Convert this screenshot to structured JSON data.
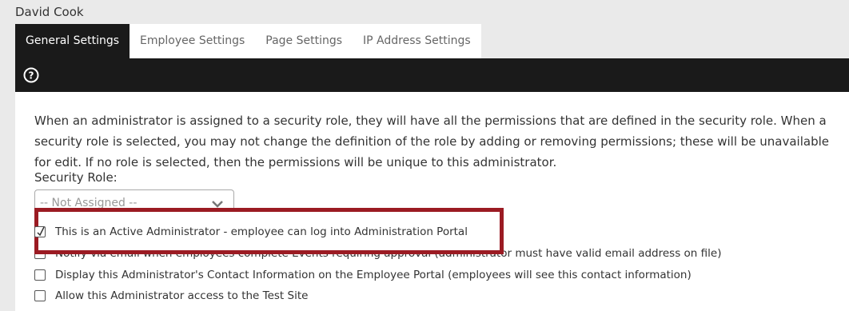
{
  "header": {
    "user_name": "David Cook"
  },
  "tabs": [
    {
      "label": "General Settings",
      "active": true
    },
    {
      "label": "Employee Settings",
      "active": false
    },
    {
      "label": "Page Settings",
      "active": false
    },
    {
      "label": "IP Address Settings",
      "active": false
    }
  ],
  "toolbar": {
    "help_icon": "question-circle-icon"
  },
  "content": {
    "description": "When an administrator is assigned to a security role, they will have all the permissions that are defined in the security role. When a security role is selected, you may not change the definition of the role by adding or removing permissions; these will be unavailable for edit. If no role is selected, then the permissions will be unique to this administrator.",
    "security_role_label": "Security Role:",
    "security_role_value": "-- Not Assigned --",
    "options": [
      {
        "label": "This is an Active Administrator - employee can log into Administration Portal",
        "checked": true
      },
      {
        "label": "Notify via email when employees complete Events requiring approval (administrator must have valid email address on file)",
        "checked": false
      },
      {
        "label": "Display this Administrator's Contact Information on the Employee Portal (employees will see this contact information)",
        "checked": false
      },
      {
        "label": "Allow this Administrator access to the Test Site",
        "checked": false
      }
    ]
  },
  "colors": {
    "tab_active_bg": "#1a1a1a",
    "highlight_border": "#9b1b23"
  }
}
